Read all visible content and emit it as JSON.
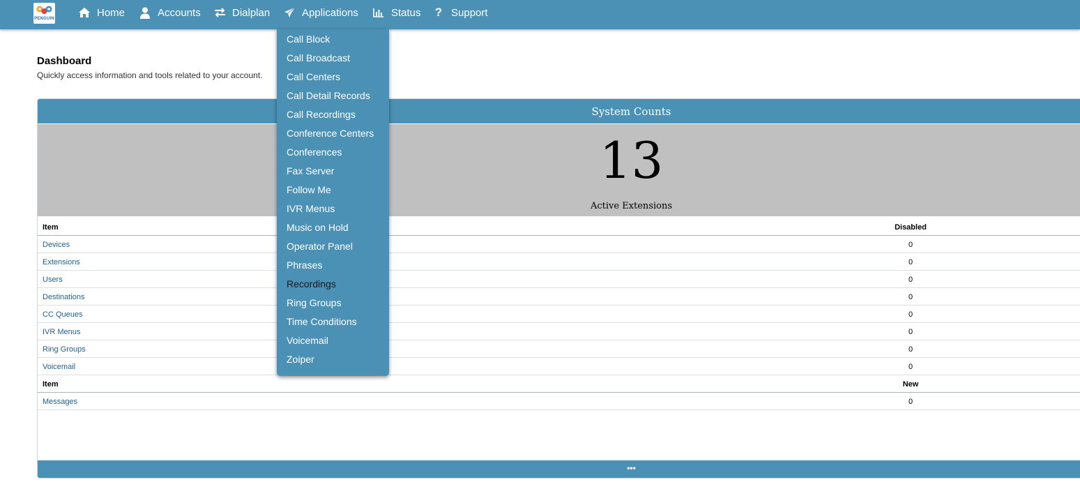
{
  "nav": {
    "logo_text": "PENGUIN",
    "items": [
      {
        "label": "Home",
        "icon": "home-icon"
      },
      {
        "label": "Accounts",
        "icon": "user-icon"
      },
      {
        "label": "Dialplan",
        "icon": "exchange-icon"
      },
      {
        "label": "Applications",
        "icon": "send-icon"
      },
      {
        "label": "Status",
        "icon": "bar-chart-icon"
      },
      {
        "label": "Support",
        "icon": "question-icon"
      }
    ]
  },
  "dashboard": {
    "title": "Dashboard",
    "subtitle": "Quickly access information and tools related to your account."
  },
  "system_counts": {
    "title": "System Counts",
    "count": "13",
    "count_label": "Active Extensions",
    "table1": {
      "headers": [
        "Item",
        "Disabled"
      ],
      "rows": [
        {
          "item": "Devices",
          "value": "0"
        },
        {
          "item": "Extensions",
          "value": "0"
        },
        {
          "item": "Users",
          "value": "0"
        },
        {
          "item": "Destinations",
          "value": "0"
        },
        {
          "item": "CC Queues",
          "value": "0"
        },
        {
          "item": "IVR Menus",
          "value": "0"
        },
        {
          "item": "Ring Groups",
          "value": "0"
        },
        {
          "item": "Voicemail",
          "value": "0"
        }
      ]
    },
    "table2": {
      "headers": [
        "Item",
        "New"
      ],
      "rows": [
        {
          "item": "Messages",
          "value": "0"
        }
      ]
    },
    "footer": "•••"
  },
  "applications_menu": {
    "items": [
      "Call Block",
      "Call Broadcast",
      "Call Centers",
      "Call Detail Records",
      "Call Recordings",
      "Conference Centers",
      "Conferences",
      "Fax Server",
      "Follow Me",
      "IVR Menus",
      "Music on Hold",
      "Operator Panel",
      "Phrases",
      "Recordings",
      "Ring Groups",
      "Time Conditions",
      "Voicemail",
      "Zoiper"
    ],
    "highlighted": "Recordings"
  },
  "colors": {
    "nav_bg": "#4b91b5",
    "hero_bg": "#c0c0c0",
    "link": "#1f5f8f"
  }
}
